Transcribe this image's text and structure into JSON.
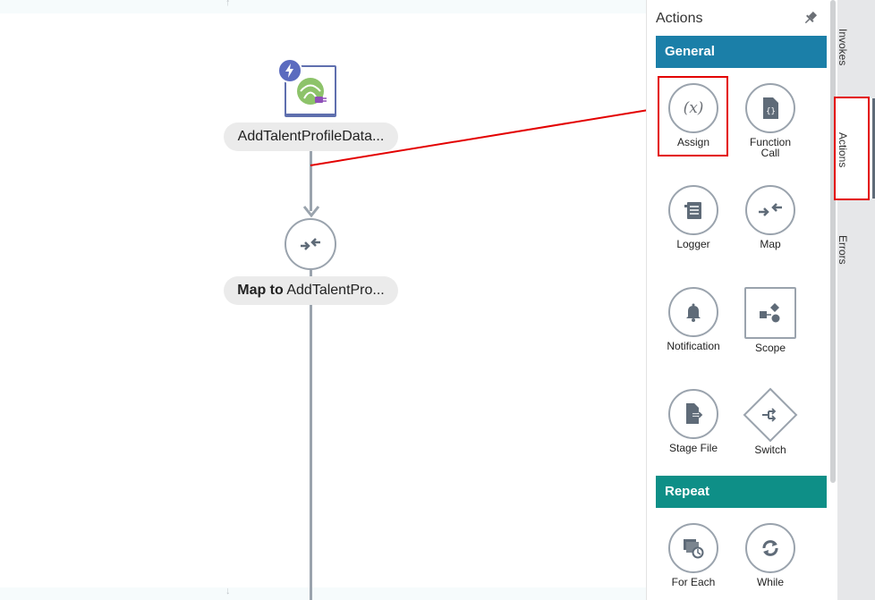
{
  "canvas": {
    "nodes": [
      {
        "label": "AddTalentProfileData..."
      },
      {
        "label_bold": "Map to",
        "label_rest": "AddTalentPro..."
      }
    ]
  },
  "panel": {
    "title": "Actions",
    "sections": [
      {
        "name": "General",
        "items": [
          {
            "label": "Assign",
            "icon": "assign-icon"
          },
          {
            "label": "Function\nCall",
            "icon": "function-call-icon"
          },
          {
            "label": "Logger",
            "icon": "logger-icon"
          },
          {
            "label": "Map",
            "icon": "map-icon"
          },
          {
            "label": "Notification",
            "icon": "notification-icon"
          },
          {
            "label": "Scope",
            "icon": "scope-icon"
          },
          {
            "label": "Stage File",
            "icon": "stage-file-icon"
          },
          {
            "label": "Switch",
            "icon": "switch-icon"
          }
        ]
      },
      {
        "name": "Repeat",
        "items": [
          {
            "label": "For Each",
            "icon": "for-each-icon"
          },
          {
            "label": "While",
            "icon": "while-icon"
          }
        ]
      }
    ]
  },
  "tabs": [
    {
      "label": "Invokes"
    },
    {
      "label": "Actions"
    },
    {
      "label": "Errors"
    }
  ],
  "colors": {
    "general_header": "#1b7fa8",
    "repeat_header": "#0e8f87",
    "highlight": "#e30000",
    "trigger_badge": "#5b6bbf"
  }
}
